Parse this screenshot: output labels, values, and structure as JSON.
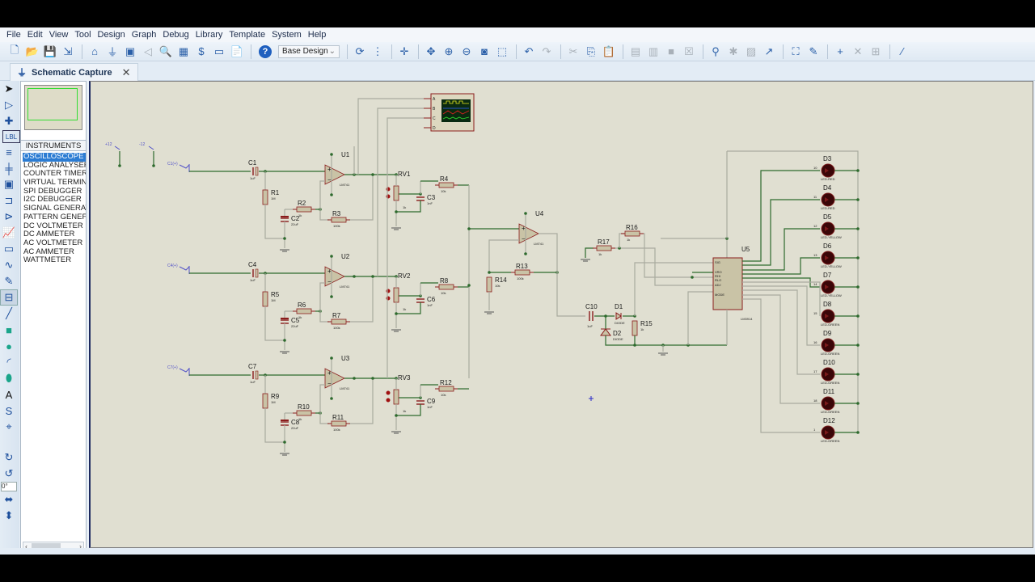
{
  "menu": [
    "File",
    "Edit",
    "View",
    "Tool",
    "Design",
    "Graph",
    "Debug",
    "Library",
    "Template",
    "System",
    "Help"
  ],
  "toolbar": {
    "variant_select": "Base Design",
    "icons_left": [
      "new-file",
      "open-folder",
      "save",
      "import",
      "home",
      "schematic",
      "pcb",
      "back",
      "zoom-ref",
      "3d-view",
      "bill",
      "netlist",
      "doc",
      "help"
    ],
    "icons_mid": [
      "refresh",
      "grid",
      "origin",
      "pan",
      "zoom-in",
      "zoom-out",
      "zoom-all",
      "zoom-area",
      "undo",
      "redo",
      "cut",
      "copy",
      "paste",
      "block-copy",
      "block-move",
      "block-rotate",
      "block-delete",
      "pick-device",
      "make-device",
      "package",
      "auto-router",
      "search",
      "property-assign",
      "new-sheet",
      "delete-sheet",
      "subcircuit",
      "design-explorer"
    ]
  },
  "tab": {
    "label": "Schematic Capture",
    "close": "✕"
  },
  "left_tools": [
    "select",
    "component",
    "junction",
    "wire-label",
    "text-script",
    "bus",
    "subcircuit",
    "terminal",
    "device-pin",
    "graph",
    "active-popup",
    "generator",
    "probe",
    "virtual-instrument",
    "line",
    "box",
    "circle",
    "arc",
    "path",
    "text",
    "symbol",
    "marker",
    "rotate-cw",
    "rotate-ccw",
    "rotation-angle",
    "flip-h",
    "flip-v"
  ],
  "rotation_value": "0°",
  "panel": {
    "header": "INSTRUMENTS",
    "items": [
      "OSCILLOSCOPE",
      "LOGIC ANALYSER",
      "COUNTER TIMER",
      "VIRTUAL TERMIN",
      "SPI DEBUGGER",
      "I2C DEBUGGER",
      "SIGNAL GENERAT",
      "PATTERN GENEF",
      "DC VOLTMETER",
      "DC AMMETER",
      "AC VOLTMETER",
      "AC AMMETER",
      "WATTMETER"
    ],
    "selected": 0
  },
  "schematic": {
    "terminals": [
      {
        "label": "+12"
      },
      {
        "label": "-12"
      },
      {
        "label": "C1(+)"
      },
      {
        "label": "C4(+)"
      },
      {
        "label": "C7(+)"
      }
    ],
    "oscilloscope": {
      "channels": [
        "A",
        "B",
        "C",
        "D"
      ]
    },
    "stages": [
      {
        "cin": "C1",
        "cin_v": "1uF",
        "r_in": "R1",
        "r_in_v": "1M",
        "r_g": "R2",
        "r_g_v": "1k",
        "c_g": "C2",
        "c_g_v": "22uF",
        "r_f": "R3",
        "r_f_v": "100k",
        "op": "U1",
        "op_v": "LM741",
        "pot": "RV1",
        "pot_v": "1k",
        "r_o": "R4",
        "r_o_v": "10k",
        "c_o": "C3",
        "c_o_v": "1nF"
      },
      {
        "cin": "C4",
        "cin_v": "1uF",
        "r_in": "R5",
        "r_in_v": "1M",
        "r_g": "R6",
        "r_g_v": "1k",
        "c_g": "C5",
        "c_g_v": "22uF",
        "r_f": "R7",
        "r_f_v": "100k",
        "op": "U2",
        "op_v": "LM741",
        "pot": "RV2",
        "pot_v": "1k",
        "r_o": "R8",
        "r_o_v": "10k",
        "c_o": "C6",
        "c_o_v": "1nF"
      },
      {
        "cin": "C7",
        "cin_v": "1uF",
        "r_in": "R9",
        "r_in_v": "1M",
        "r_g": "R10",
        "r_g_v": "1k",
        "c_g": "C8",
        "c_g_v": "22uF",
        "r_f": "R11",
        "r_f_v": "100k",
        "op": "U3",
        "op_v": "LM741",
        "pot": "RV3",
        "pot_v": "1k",
        "r_o": "R12",
        "r_o_v": "10k",
        "c_o": "C9",
        "c_o_v": "1nF"
      }
    ],
    "mixer": {
      "op": "U4",
      "op_v": "LM741",
      "r13": "R13",
      "r13_v": "100k",
      "r14": "R14",
      "r14_v": "10k"
    },
    "rectifier": {
      "c10": "C10",
      "c10_v": "1uF",
      "d1": "D1",
      "d1_v": "DIODE",
      "d2": "D2",
      "d2_v": "DIODE",
      "r15": "R15",
      "r15_v": "1k",
      "r16": "R16",
      "r16_v": "1k",
      "r17": "R17",
      "r17_v": "1k"
    },
    "driver": {
      "name": "U5",
      "part": "LM3914",
      "pins_left": [
        "SIG",
        "VRO",
        "RHI",
        "RLO",
        "ADJ",
        "MODE"
      ]
    },
    "leds": [
      {
        "ref": "D3",
        "type": "LED-RED",
        "pin": "10"
      },
      {
        "ref": "D4",
        "type": "LED-RED",
        "pin": "11"
      },
      {
        "ref": "D5",
        "type": "LED-YELLOW",
        "pin": "12"
      },
      {
        "ref": "D6",
        "type": "LED-YELLOW",
        "pin": "13"
      },
      {
        "ref": "D7",
        "type": "LED-YELLOW",
        "pin": "14"
      },
      {
        "ref": "D8",
        "type": "LED-GREEN",
        "pin": "15"
      },
      {
        "ref": "D9",
        "type": "LED-GREEN",
        "pin": "16"
      },
      {
        "ref": "D10",
        "type": "LED-GREEN",
        "pin": "17"
      },
      {
        "ref": "D11",
        "type": "LED-GREEN",
        "pin": "18"
      },
      {
        "ref": "D12",
        "type": "LED-GREEN",
        "pin": "1"
      }
    ]
  },
  "colors": {
    "wire": "#2d6a2d",
    "wire_gray": "#a9ab9f",
    "part": "#8a1c1c",
    "fill": "#c9c3a6",
    "canvas": "#e0dfd1",
    "label": "#1a1a1a",
    "terminal": "#5252c8",
    "accent": "#2b7cd3"
  }
}
